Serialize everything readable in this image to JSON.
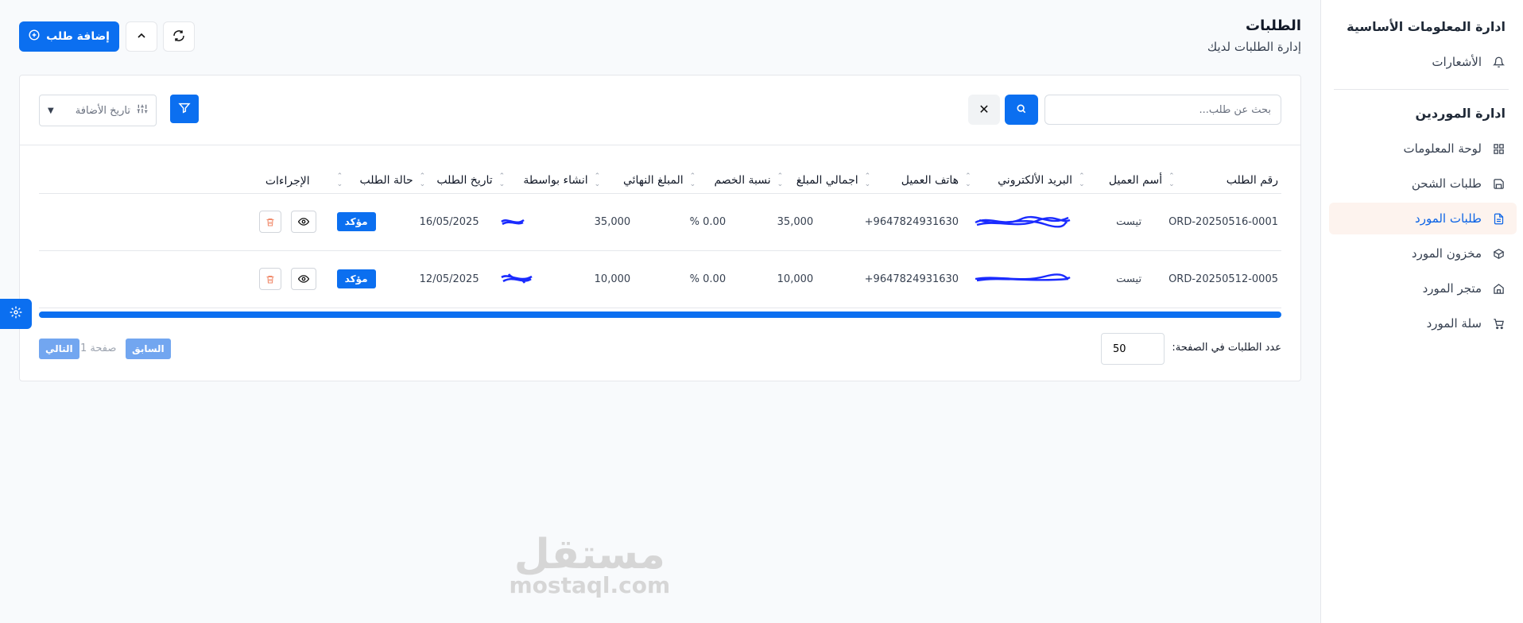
{
  "sidebar": {
    "sections": [
      {
        "title": "ادارة المعلومات الأساسية",
        "items": [
          {
            "label": "الأشعارات",
            "icon": "bell-icon"
          }
        ]
      },
      {
        "title": "ادارة الموردين",
        "items": [
          {
            "label": "لوحة المعلومات",
            "icon": "grid-icon"
          },
          {
            "label": "طلبات الشحن",
            "icon": "save-icon"
          },
          {
            "label": "طلبات المورد",
            "icon": "file-icon",
            "active": true
          },
          {
            "label": "مخزون المورد",
            "icon": "box-icon"
          },
          {
            "label": "متجر المورد",
            "icon": "home-icon"
          },
          {
            "label": "سلة المورد",
            "icon": "cart-icon"
          }
        ]
      }
    ]
  },
  "header": {
    "title": "الطلبات",
    "subtitle": "إدارة الطلبات لديك",
    "add_label": "إضافة طلب"
  },
  "toolbar": {
    "search_placeholder": "بحث عن طلب...",
    "clear_label": "✕",
    "sort_label": "تاريخ الأضافة"
  },
  "table": {
    "columns": [
      "رقم الطلب",
      "أسم العميل",
      "البريد الألكتروني",
      "هاتف العميل",
      "اجمالي المبلغ",
      "نسبة الخصم",
      "المبلغ النهائي",
      "انشاء بواسطة",
      "تاريخ الطلب",
      "حالة الطلب",
      "الإجراءات"
    ],
    "rows": [
      {
        "order_no": "ORD-20250516-0001",
        "customer": "تيست",
        "phone": "+9647824931630",
        "total": "35,000",
        "discount": "0.00 %",
        "final": "35,000",
        "date": "16/05/2025",
        "status": "مؤكد"
      },
      {
        "order_no": "ORD-20250512-0005",
        "customer": "تيست",
        "phone": "+9647824931630",
        "total": "10,000",
        "discount": "0.00 %",
        "final": "10,000",
        "date": "12/05/2025",
        "status": "مؤكد"
      }
    ]
  },
  "pager": {
    "per_page_label": "عدد الطلبات في الصفحة:",
    "per_page_value": "50",
    "prev_label": "السابق",
    "page_text": "صفحة 1",
    "next_label": "التالي"
  },
  "watermark": {
    "ar": "مستقل",
    "en": "mostaql.com"
  },
  "colors": {
    "primary": "#0b6ff0",
    "active_bg": "#fdf3ee",
    "delete": "#f08a6b"
  }
}
